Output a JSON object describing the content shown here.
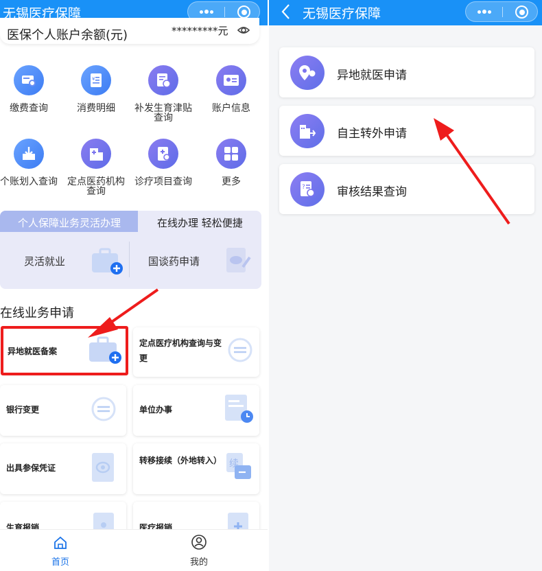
{
  "left": {
    "app_title": "无锡医疗保障",
    "balance": {
      "label": "医保个人账户余额(元)",
      "masked_value": "*********元"
    },
    "grid": [
      {
        "label": "缴费查询",
        "icon": "search-card-icon"
      },
      {
        "label": "消费明细",
        "icon": "receipt-icon"
      },
      {
        "label": "补发生育津贴查询",
        "icon": "allowance-doc-icon"
      },
      {
        "label": "账户信息",
        "icon": "id-card-icon"
      },
      {
        "label": "个账划入查询",
        "icon": "inbox-download-icon"
      },
      {
        "label": "定点医药机构查询",
        "icon": "hospital-building-icon"
      },
      {
        "label": "诊疗项目查询",
        "icon": "medical-book-icon"
      },
      {
        "label": "更多",
        "icon": "grid-more-icon"
      }
    ],
    "tabs": {
      "active": "个人保障业务灵活办理",
      "inactive": "在线办理 轻松便捷"
    },
    "services": [
      "灵活就业",
      "国谈药申请"
    ],
    "section_title": "在线业务申请",
    "tiles": [
      "异地就医备案",
      "定点医疗机构查询与变更",
      "银行变更",
      "单位办事",
      "出具参保凭证",
      "转移接续（外地转入）",
      "生育报销",
      "医疗报销"
    ],
    "nav": {
      "home": "首页",
      "mine": "我的"
    }
  },
  "right": {
    "app_title": "无锡医疗保障",
    "cards": [
      {
        "label": "异地就医申请",
        "icon": "location-pin-icon"
      },
      {
        "label": "自主转外申请",
        "icon": "building-transfer-icon"
      },
      {
        "label": "审核结果查询",
        "icon": "document-search-icon"
      }
    ]
  },
  "colors": {
    "topbar": "#1991f7",
    "accent_purple": "#6b70ea",
    "annotation_red": "#ee1c1c",
    "nav_active": "#1a73e8"
  }
}
